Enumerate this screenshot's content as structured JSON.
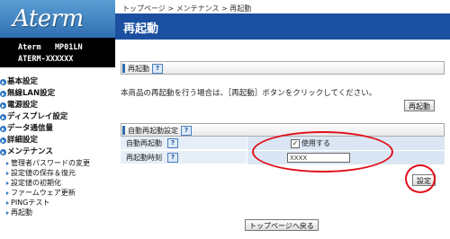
{
  "sidebar": {
    "logo": "Aterm",
    "device_model": "Aterm   MP01LN",
    "device_name": "ATERM-XXXXXX",
    "items": [
      {
        "label": "基本設定"
      },
      {
        "label": "無線LAN設定"
      },
      {
        "label": "電源設定"
      },
      {
        "label": "ディスプレイ設定"
      },
      {
        "label": "データ通信量"
      },
      {
        "label": "詳細設定"
      },
      {
        "label": "メンテナンス"
      }
    ],
    "sub_items": [
      {
        "label": "管理者パスワードの変更"
      },
      {
        "label": "設定値の保存＆復元"
      },
      {
        "label": "設定値の初期化"
      },
      {
        "label": "ファームウェア更新"
      },
      {
        "label": "PINGテスト"
      },
      {
        "label": "再起動"
      }
    ]
  },
  "breadcrumb": "トップページ > メンテナンス > 再起動",
  "page_title": "再起動",
  "restart_section": {
    "heading": "再起動",
    "help": "?",
    "description": "本商品の再起動を行う場合は、［再起動］ボタンをクリックしてください。",
    "button_label": "再起動"
  },
  "auto_section": {
    "heading": "自動再起動設定",
    "help": "?",
    "rows": [
      {
        "label": "自動再起動",
        "help": "?",
        "checkbox_checked": true,
        "checkbox_label": "使用する"
      },
      {
        "label": "再起動時刻",
        "help": "?",
        "input_value": "XXXX"
      }
    ],
    "settings_button": "設定"
  },
  "back_button": "トップページへ戻る",
  "colors": {
    "title_bar": "#1b4fa0",
    "highlight": "#e0101a"
  }
}
